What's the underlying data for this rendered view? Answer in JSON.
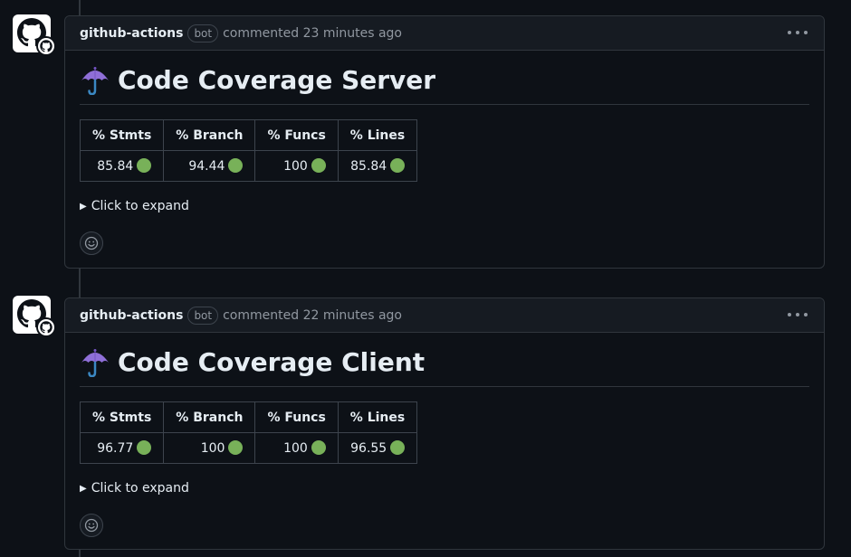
{
  "comments": [
    {
      "author": "github-actions",
      "badge": "bot",
      "time": "commented 23 minutes ago",
      "title": "Code Coverage Server",
      "headers": [
        "% Stmts",
        "% Branch",
        "% Funcs",
        "% Lines"
      ],
      "values": [
        "85.84",
        "94.44",
        "100",
        "85.84"
      ],
      "expand_label": "Click to expand"
    },
    {
      "author": "github-actions",
      "badge": "bot",
      "time": "commented 22 minutes ago",
      "title": "Code Coverage Client",
      "headers": [
        "% Stmts",
        "% Branch",
        "% Funcs",
        "% Lines"
      ],
      "values": [
        "96.77",
        "100",
        "100",
        "96.55"
      ],
      "expand_label": "Click to expand"
    }
  ],
  "icons": {
    "avatar": "github-octocat-icon",
    "title_emoji": "umbrella-icon",
    "status": "green-circle-icon",
    "menu": "kebab-horizontal-icon",
    "reaction": "smiley-icon"
  },
  "colors": {
    "background": "#0d1117",
    "header": "#161b22",
    "border": "#30363d",
    "text": "#e6edf3",
    "muted": "#9198a1",
    "status_green": "#78b159"
  }
}
